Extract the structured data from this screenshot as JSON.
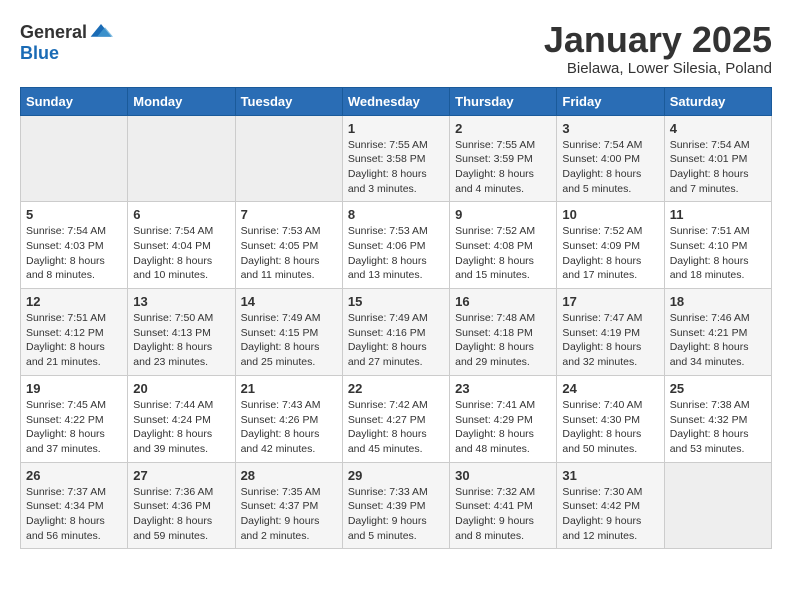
{
  "logo": {
    "text_general": "General",
    "text_blue": "Blue"
  },
  "title": "January 2025",
  "subtitle": "Bielawa, Lower Silesia, Poland",
  "headers": [
    "Sunday",
    "Monday",
    "Tuesday",
    "Wednesday",
    "Thursday",
    "Friday",
    "Saturday"
  ],
  "weeks": [
    [
      {
        "day": "",
        "text": ""
      },
      {
        "day": "",
        "text": ""
      },
      {
        "day": "",
        "text": ""
      },
      {
        "day": "1",
        "text": "Sunrise: 7:55 AM\nSunset: 3:58 PM\nDaylight: 8 hours and 3 minutes."
      },
      {
        "day": "2",
        "text": "Sunrise: 7:55 AM\nSunset: 3:59 PM\nDaylight: 8 hours and 4 minutes."
      },
      {
        "day": "3",
        "text": "Sunrise: 7:54 AM\nSunset: 4:00 PM\nDaylight: 8 hours and 5 minutes."
      },
      {
        "day": "4",
        "text": "Sunrise: 7:54 AM\nSunset: 4:01 PM\nDaylight: 8 hours and 7 minutes."
      }
    ],
    [
      {
        "day": "5",
        "text": "Sunrise: 7:54 AM\nSunset: 4:03 PM\nDaylight: 8 hours and 8 minutes."
      },
      {
        "day": "6",
        "text": "Sunrise: 7:54 AM\nSunset: 4:04 PM\nDaylight: 8 hours and 10 minutes."
      },
      {
        "day": "7",
        "text": "Sunrise: 7:53 AM\nSunset: 4:05 PM\nDaylight: 8 hours and 11 minutes."
      },
      {
        "day": "8",
        "text": "Sunrise: 7:53 AM\nSunset: 4:06 PM\nDaylight: 8 hours and 13 minutes."
      },
      {
        "day": "9",
        "text": "Sunrise: 7:52 AM\nSunset: 4:08 PM\nDaylight: 8 hours and 15 minutes."
      },
      {
        "day": "10",
        "text": "Sunrise: 7:52 AM\nSunset: 4:09 PM\nDaylight: 8 hours and 17 minutes."
      },
      {
        "day": "11",
        "text": "Sunrise: 7:51 AM\nSunset: 4:10 PM\nDaylight: 8 hours and 18 minutes."
      }
    ],
    [
      {
        "day": "12",
        "text": "Sunrise: 7:51 AM\nSunset: 4:12 PM\nDaylight: 8 hours and 21 minutes."
      },
      {
        "day": "13",
        "text": "Sunrise: 7:50 AM\nSunset: 4:13 PM\nDaylight: 8 hours and 23 minutes."
      },
      {
        "day": "14",
        "text": "Sunrise: 7:49 AM\nSunset: 4:15 PM\nDaylight: 8 hours and 25 minutes."
      },
      {
        "day": "15",
        "text": "Sunrise: 7:49 AM\nSunset: 4:16 PM\nDaylight: 8 hours and 27 minutes."
      },
      {
        "day": "16",
        "text": "Sunrise: 7:48 AM\nSunset: 4:18 PM\nDaylight: 8 hours and 29 minutes."
      },
      {
        "day": "17",
        "text": "Sunrise: 7:47 AM\nSunset: 4:19 PM\nDaylight: 8 hours and 32 minutes."
      },
      {
        "day": "18",
        "text": "Sunrise: 7:46 AM\nSunset: 4:21 PM\nDaylight: 8 hours and 34 minutes."
      }
    ],
    [
      {
        "day": "19",
        "text": "Sunrise: 7:45 AM\nSunset: 4:22 PM\nDaylight: 8 hours and 37 minutes."
      },
      {
        "day": "20",
        "text": "Sunrise: 7:44 AM\nSunset: 4:24 PM\nDaylight: 8 hours and 39 minutes."
      },
      {
        "day": "21",
        "text": "Sunrise: 7:43 AM\nSunset: 4:26 PM\nDaylight: 8 hours and 42 minutes."
      },
      {
        "day": "22",
        "text": "Sunrise: 7:42 AM\nSunset: 4:27 PM\nDaylight: 8 hours and 45 minutes."
      },
      {
        "day": "23",
        "text": "Sunrise: 7:41 AM\nSunset: 4:29 PM\nDaylight: 8 hours and 48 minutes."
      },
      {
        "day": "24",
        "text": "Sunrise: 7:40 AM\nSunset: 4:30 PM\nDaylight: 8 hours and 50 minutes."
      },
      {
        "day": "25",
        "text": "Sunrise: 7:38 AM\nSunset: 4:32 PM\nDaylight: 8 hours and 53 minutes."
      }
    ],
    [
      {
        "day": "26",
        "text": "Sunrise: 7:37 AM\nSunset: 4:34 PM\nDaylight: 8 hours and 56 minutes."
      },
      {
        "day": "27",
        "text": "Sunrise: 7:36 AM\nSunset: 4:36 PM\nDaylight: 8 hours and 59 minutes."
      },
      {
        "day": "28",
        "text": "Sunrise: 7:35 AM\nSunset: 4:37 PM\nDaylight: 9 hours and 2 minutes."
      },
      {
        "day": "29",
        "text": "Sunrise: 7:33 AM\nSunset: 4:39 PM\nDaylight: 9 hours and 5 minutes."
      },
      {
        "day": "30",
        "text": "Sunrise: 7:32 AM\nSunset: 4:41 PM\nDaylight: 9 hours and 8 minutes."
      },
      {
        "day": "31",
        "text": "Sunrise: 7:30 AM\nSunset: 4:42 PM\nDaylight: 9 hours and 12 minutes."
      },
      {
        "day": "",
        "text": ""
      }
    ]
  ]
}
